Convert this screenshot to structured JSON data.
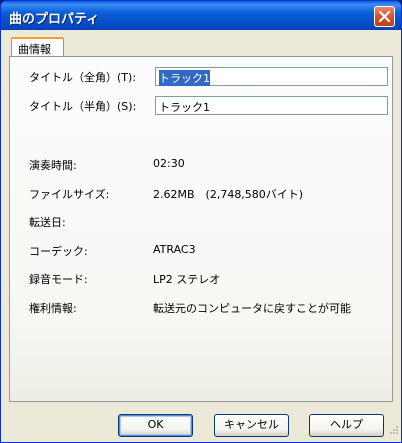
{
  "window": {
    "title": "曲のプロパティ"
  },
  "tab": {
    "label": "曲情報"
  },
  "form": {
    "title_full_label": "タイトル（全角）(T):",
    "title_full_value": "トラック1",
    "title_half_label": "タイトル（半角）(S):",
    "title_half_value": "トラック1"
  },
  "info": [
    {
      "label": "演奏時間:",
      "value": "02:30"
    },
    {
      "label": "ファイルサイズ:",
      "value": "2.62MB　(2,748,580バイト)"
    },
    {
      "label": "転送日:",
      "value": ""
    },
    {
      "label": "コーデック:",
      "value": "ATRAC3"
    },
    {
      "label": "録音モード:",
      "value": "LP2 ステレオ"
    },
    {
      "label": "権利情報:",
      "value": "転送元のコンピュータに戻すことが可能"
    }
  ],
  "buttons": {
    "ok": "OK",
    "cancel": "キャンセル",
    "help": "ヘルプ"
  },
  "icons": {
    "close": "close-icon",
    "resize": "resize-grip-icon"
  }
}
